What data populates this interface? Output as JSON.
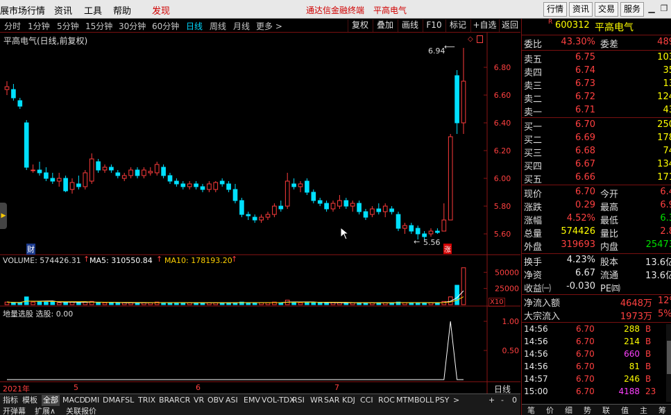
{
  "menu": {
    "items": [
      "展市场行情",
      "资讯",
      "工具",
      "帮助"
    ],
    "discover": "发现",
    "app_title": "通达信金融终端",
    "stock_title": "平高电气",
    "right_buttons": [
      "行情",
      "资讯",
      "交易",
      "服务"
    ]
  },
  "periods": [
    "分时",
    "1分钟",
    "5分钟",
    "15分钟",
    "30分钟",
    "60分钟",
    "日线",
    "周线",
    "月线",
    "更多 >"
  ],
  "active_period": "日线",
  "toolbar": [
    "复权",
    "叠加",
    "画线",
    "F10",
    "标记",
    "+自选",
    "返回"
  ],
  "chart": {
    "title": "平高电气(日线,前复权)",
    "high_label": "6.94",
    "low_label": "5.56",
    "fin_label": "财",
    "limit_label": "涨",
    "price_ticks": [
      "6.80",
      "6.60",
      "6.40",
      "6.20",
      "6.00",
      "5.80",
      "5.60"
    ],
    "volume_legend": {
      "vol_label": "VOLUME: 574426.31",
      "ma5_label": "MA5: 310550.84",
      "ma10_label": "MA10: 178193.20"
    },
    "volume_ticks": [
      "50000",
      "25000"
    ],
    "volume_unit": "X10",
    "indicator_legend": "地量选股 选股: 0.00",
    "indicator_ticks": [
      "1.00",
      "0.50"
    ],
    "date_labels": [
      "2021年",
      "5",
      "6",
      "7"
    ],
    "period_label": "日线"
  },
  "chart_data": {
    "type": "candlestick",
    "ylim": [
      5.5,
      6.95
    ],
    "candles": [
      {
        "o": 6.64,
        "h": 6.7,
        "l": 6.6,
        "c": 6.66
      },
      {
        "o": 6.64,
        "h": 6.68,
        "l": 6.56,
        "c": 6.58
      },
      {
        "o": 6.56,
        "h": 6.58,
        "l": 6.5,
        "c": 6.52
      },
      {
        "o": 6.4,
        "h": 6.42,
        "l": 6.06,
        "c": 6.08
      },
      {
        "o": 6.06,
        "h": 6.1,
        "l": 6.04,
        "c": 6.06
      },
      {
        "o": 6.06,
        "h": 6.12,
        "l": 6.02,
        "c": 6.04
      },
      {
        "o": 6.04,
        "h": 6.08,
        "l": 5.98,
        "c": 6.0
      },
      {
        "o": 6.0,
        "h": 6.04,
        "l": 5.96,
        "c": 5.98
      },
      {
        "o": 5.98,
        "h": 6.04,
        "l": 5.94,
        "c": 6.0
      },
      {
        "o": 6.0,
        "h": 6.02,
        "l": 5.9,
        "c": 5.91
      },
      {
        "o": 5.92,
        "h": 6.0,
        "l": 5.89,
        "c": 5.97
      },
      {
        "o": 5.96,
        "h": 6.02,
        "l": 5.92,
        "c": 5.94
      },
      {
        "o": 5.94,
        "h": 6.06,
        "l": 5.92,
        "c": 6.04
      },
      {
        "o": 5.98,
        "h": 6.18,
        "l": 5.96,
        "c": 6.14
      },
      {
        "o": 6.12,
        "h": 6.14,
        "l": 6.04,
        "c": 6.06
      },
      {
        "o": 6.06,
        "h": 6.1,
        "l": 6.04,
        "c": 6.08
      },
      {
        "o": 6.08,
        "h": 6.1,
        "l": 6.04,
        "c": 6.06
      },
      {
        "o": 6.04,
        "h": 6.06,
        "l": 6.0,
        "c": 6.02
      },
      {
        "o": 6.0,
        "h": 6.04,
        "l": 5.98,
        "c": 6.02
      },
      {
        "o": 6.02,
        "h": 6.08,
        "l": 6.0,
        "c": 6.06
      },
      {
        "o": 6.06,
        "h": 6.08,
        "l": 6.0,
        "c": 6.02
      },
      {
        "o": 6.02,
        "h": 6.08,
        "l": 6.0,
        "c": 6.06
      },
      {
        "o": 6.04,
        "h": 6.08,
        "l": 6.02,
        "c": 6.05
      },
      {
        "o": 6.04,
        "h": 6.12,
        "l": 6.02,
        "c": 6.1
      },
      {
        "o": 6.08,
        "h": 6.1,
        "l": 6.0,
        "c": 6.02
      },
      {
        "o": 6.02,
        "h": 6.04,
        "l": 5.96,
        "c": 5.98
      },
      {
        "o": 5.98,
        "h": 6.0,
        "l": 5.94,
        "c": 5.96
      },
      {
        "o": 5.96,
        "h": 5.98,
        "l": 5.92,
        "c": 5.94
      },
      {
        "o": 5.94,
        "h": 5.98,
        "l": 5.92,
        "c": 5.96
      },
      {
        "o": 5.96,
        "h": 5.98,
        "l": 5.92,
        "c": 5.94
      },
      {
        "o": 5.94,
        "h": 5.96,
        "l": 5.9,
        "c": 5.92
      },
      {
        "o": 5.92,
        "h": 5.98,
        "l": 5.9,
        "c": 5.96
      },
      {
        "o": 5.92,
        "h": 5.98,
        "l": 5.9,
        "c": 5.97
      },
      {
        "o": 5.98,
        "h": 6.0,
        "l": 5.94,
        "c": 5.96
      },
      {
        "o": 5.96,
        "h": 5.98,
        "l": 5.9,
        "c": 5.92
      },
      {
        "o": 5.92,
        "h": 5.96,
        "l": 5.82,
        "c": 5.84
      },
      {
        "o": 5.84,
        "h": 5.86,
        "l": 5.72,
        "c": 5.74
      },
      {
        "o": 5.74,
        "h": 5.76,
        "l": 5.7,
        "c": 5.73
      },
      {
        "o": 5.72,
        "h": 5.74,
        "l": 5.68,
        "c": 5.7
      },
      {
        "o": 5.7,
        "h": 5.74,
        "l": 5.68,
        "c": 5.72
      },
      {
        "o": 5.72,
        "h": 5.76,
        "l": 5.7,
        "c": 5.74
      },
      {
        "o": 5.74,
        "h": 5.82,
        "l": 5.72,
        "c": 5.8
      },
      {
        "o": 5.8,
        "h": 5.84,
        "l": 5.76,
        "c": 5.78
      },
      {
        "o": 5.8,
        "h": 6.04,
        "l": 5.78,
        "c": 5.98
      },
      {
        "o": 5.96,
        "h": 6.0,
        "l": 5.92,
        "c": 5.94
      },
      {
        "o": 5.94,
        "h": 5.98,
        "l": 5.9,
        "c": 5.96
      },
      {
        "o": 5.98,
        "h": 6.0,
        "l": 5.88,
        "c": 5.9
      },
      {
        "o": 5.9,
        "h": 5.92,
        "l": 5.82,
        "c": 5.84
      },
      {
        "o": 5.84,
        "h": 5.86,
        "l": 5.8,
        "c": 5.82
      },
      {
        "o": 5.82,
        "h": 5.84,
        "l": 5.76,
        "c": 5.78
      },
      {
        "o": 5.78,
        "h": 5.84,
        "l": 5.76,
        "c": 5.82
      },
      {
        "o": 5.8,
        "h": 5.88,
        "l": 5.78,
        "c": 5.84
      },
      {
        "o": 5.84,
        "h": 5.86,
        "l": 5.78,
        "c": 5.8
      },
      {
        "o": 5.8,
        "h": 5.84,
        "l": 5.76,
        "c": 5.82
      },
      {
        "o": 5.82,
        "h": 5.84,
        "l": 5.74,
        "c": 5.76
      },
      {
        "o": 5.76,
        "h": 5.78,
        "l": 5.7,
        "c": 5.72
      },
      {
        "o": 5.74,
        "h": 5.8,
        "l": 5.72,
        "c": 5.78
      },
      {
        "o": 5.78,
        "h": 5.82,
        "l": 5.74,
        "c": 5.76
      },
      {
        "o": 5.76,
        "h": 5.82,
        "l": 5.72,
        "c": 5.8
      },
      {
        "o": 5.78,
        "h": 5.8,
        "l": 5.74,
        "c": 5.76
      },
      {
        "o": 5.74,
        "h": 5.76,
        "l": 5.62,
        "c": 5.64
      },
      {
        "o": 5.64,
        "h": 5.68,
        "l": 5.6,
        "c": 5.66
      },
      {
        "o": 5.66,
        "h": 5.68,
        "l": 5.6,
        "c": 5.62
      },
      {
        "o": 5.64,
        "h": 5.66,
        "l": 5.56,
        "c": 5.6
      },
      {
        "o": 5.6,
        "h": 5.62,
        "l": 5.56,
        "c": 5.58
      },
      {
        "o": 5.6,
        "h": 5.64,
        "l": 5.58,
        "c": 5.62
      },
      {
        "o": 5.62,
        "h": 5.64,
        "l": 5.6,
        "c": 5.61
      },
      {
        "o": 5.62,
        "h": 5.82,
        "l": 5.62,
        "c": 5.7
      },
      {
        "o": 5.7,
        "h": 6.32,
        "l": 5.7,
        "c": 6.3
      },
      {
        "o": 6.74,
        "h": 6.78,
        "l": 6.32,
        "c": 6.4
      },
      {
        "o": 6.4,
        "h": 6.94,
        "l": 6.32,
        "c": 6.7
      }
    ],
    "volumes": [
      4,
      3,
      3,
      12,
      4,
      5,
      4,
      4,
      3,
      4,
      4,
      3,
      4,
      5,
      3,
      3,
      3,
      3,
      3,
      3,
      3,
      3,
      3,
      4,
      3,
      3,
      3,
      3,
      3,
      3,
      3,
      3,
      3,
      3,
      3,
      3,
      4,
      3,
      3,
      3,
      3,
      4,
      3,
      7,
      4,
      3,
      4,
      3,
      3,
      3,
      3,
      3,
      3,
      3,
      3,
      3,
      3,
      3,
      3,
      3,
      4,
      3,
      3,
      3,
      3,
      3,
      3,
      5,
      12,
      30,
      57
    ],
    "volume_unit": "X10",
    "indicator": {
      "peak_index": 68,
      "value": 1.0,
      "ylim": [
        0,
        1
      ]
    }
  },
  "indicator_tabs": [
    "指标",
    "模板",
    "全部",
    "MACD",
    "DMI",
    "DMA",
    "FSL",
    "TRIX",
    "BRAR",
    "CR",
    "VR",
    "OBV",
    "ASI",
    "EMV",
    "VOL-TDX",
    "RSI",
    "WR",
    "SAR",
    "KDJ",
    "CCI",
    "ROC",
    "MTM",
    "BOLL",
    "PSY",
    ">"
  ],
  "active_indicator_tab": "全部",
  "zoom_controls": [
    "+",
    "-",
    "0"
  ],
  "sub_tabs": [
    "开弹幕",
    "扩展∧",
    "关联报价"
  ],
  "quote": {
    "code_prefix": "R",
    "code": "600312",
    "name": "平高电气",
    "weibi_label": "委比",
    "weibi_value": "43.30%",
    "weicha_label": "委差",
    "weicha_value": "489",
    "asks": [
      {
        "label": "卖五",
        "price": "6.75",
        "vol": "103"
      },
      {
        "label": "卖四",
        "price": "6.74",
        "vol": "35"
      },
      {
        "label": "卖三",
        "price": "6.73",
        "vol": "13"
      },
      {
        "label": "卖二",
        "price": "6.72",
        "vol": "124"
      },
      {
        "label": "卖一",
        "price": "6.71",
        "vol": "43"
      }
    ],
    "bids": [
      {
        "label": "买一",
        "price": "6.70",
        "vol": "250"
      },
      {
        "label": "买二",
        "price": "6.69",
        "vol": "178"
      },
      {
        "label": "买三",
        "price": "6.68",
        "vol": "74"
      },
      {
        "label": "买四",
        "price": "6.67",
        "vol": "134"
      },
      {
        "label": "买五",
        "price": "6.66",
        "vol": "171"
      }
    ],
    "stats": [
      {
        "l1": "现价",
        "v1": "6.70",
        "c1": "red",
        "l2": "今开",
        "v2": "6.4",
        "c2": "red"
      },
      {
        "l1": "涨跌",
        "v1": "0.29",
        "c1": "red",
        "l2": "最高",
        "v2": "6.9",
        "c2": "red"
      },
      {
        "l1": "涨幅",
        "v1": "4.52%",
        "c1": "red",
        "l2": "最低",
        "v2": "6.3",
        "c2": "green"
      },
      {
        "l1": "总量",
        "v1": "574426",
        "c1": "yellow",
        "l2": "量比",
        "v2": "2.8",
        "c2": "red"
      },
      {
        "l1": "外盘",
        "v1": "319693",
        "c1": "red",
        "l2": "内盘",
        "v2": "25473",
        "c2": "green"
      }
    ],
    "stats2": [
      {
        "l1": "换手",
        "v1": "4.23%",
        "c1": "white",
        "l2": "股本",
        "v2": "13.6亿",
        "c2": "white"
      },
      {
        "l1": "净资",
        "v1": "6.67",
        "c1": "white",
        "l2": "流通",
        "v2": "13.6亿",
        "c2": "white"
      },
      {
        "l1": "收益㈠",
        "v1": "-0.030",
        "c1": "white",
        "l2": "PE㈣",
        "v2": "-",
        "c2": "white"
      }
    ],
    "flows": [
      {
        "label": "净流入额",
        "value": "4648万",
        "pct": "12%"
      },
      {
        "label": "大宗流入",
        "value": "1973万",
        "pct": "5%"
      }
    ],
    "ticks": [
      {
        "time": "14:56",
        "price": "6.70",
        "vol": "288",
        "vc": "yellow",
        "side": "B"
      },
      {
        "time": "14:56",
        "price": "6.70",
        "vol": "214",
        "vc": "yellow",
        "side": "B"
      },
      {
        "time": "14:56",
        "price": "6.70",
        "vol": "660",
        "vc": "magenta",
        "side": "B"
      },
      {
        "time": "14:56",
        "price": "6.70",
        "vol": "81",
        "vc": "yellow",
        "side": "B"
      },
      {
        "time": "14:57",
        "price": "6.70",
        "vol": "246",
        "vc": "yellow",
        "side": "B"
      },
      {
        "time": "15:00",
        "price": "6.70",
        "vol": "4188",
        "vc": "magenta",
        "side": "23"
      }
    ],
    "bottom_tabs": [
      "笔",
      "价",
      "细",
      "势",
      "联",
      "值",
      "主",
      "筹"
    ]
  },
  "colors": {
    "up": "#ff3c3c",
    "down": "#00e0ff",
    "grid": "#8a1515",
    "ma5": "#ffffff",
    "ma10": "#ffd000"
  }
}
